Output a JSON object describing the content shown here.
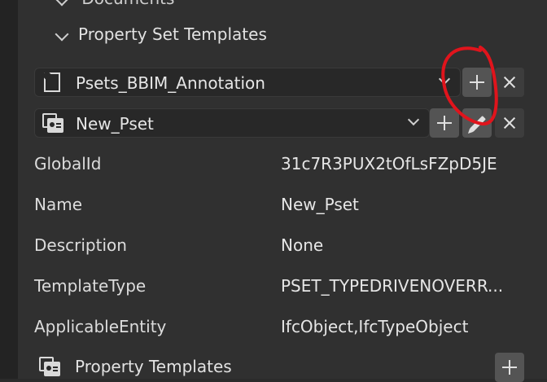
{
  "sections": {
    "previous_title": "Documents",
    "current_title": "Property Set Templates"
  },
  "template_selector": {
    "selected": "Psets_BBIM_Annotation",
    "icon": "document-icon"
  },
  "pset_selector": {
    "selected": "New_Pset",
    "icon": "pset-icon"
  },
  "buttons": {
    "add_template": "add",
    "remove_template": "remove",
    "add_pset": "add",
    "edit_pset": "edit",
    "remove_pset": "remove",
    "add_property_template": "add"
  },
  "attributes": [
    {
      "label": "GlobalId",
      "value": "31c7R3PUX2tOfLsFZpD5JE"
    },
    {
      "label": "Name",
      "value": "New_Pset"
    },
    {
      "label": "Description",
      "value": "None"
    },
    {
      "label": "TemplateType",
      "value": "PSET_TYPEDRIVENOVERR..."
    },
    {
      "label": "ApplicableEntity",
      "value": "IfcObject,IfcTypeObject"
    }
  ],
  "subsection": {
    "title": "Property Templates",
    "icon": "pset-icon"
  },
  "colors": {
    "annotation": "#e0141c",
    "panel_bg": "#303030",
    "button_bg": "#545454"
  }
}
